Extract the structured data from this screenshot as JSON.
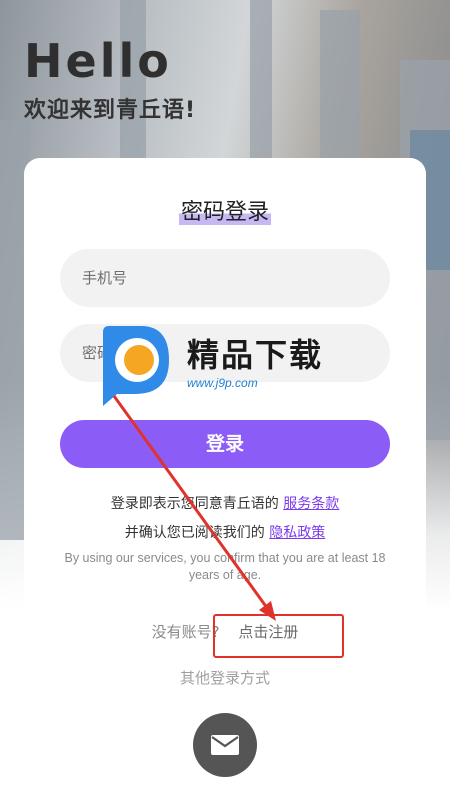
{
  "header": {
    "hello": "Hello",
    "welcome": "欢迎来到青丘语!"
  },
  "login_card": {
    "title": "密码登录",
    "phone_placeholder": "手机号",
    "password_placeholder": "密码",
    "login_button": "登录",
    "terms_prefix": "登录即表示您同意青丘语的",
    "terms_link": "服务条款",
    "privacy_prefix": "并确认您已阅读我们的",
    "privacy_link": "隐私政策",
    "age_note": "By using our services, you confirm that you are at least 18 years of age."
  },
  "register": {
    "prompt": "没有账号?",
    "link": "点击注册"
  },
  "other_login": {
    "label": "其他登录方式",
    "mail_icon": "mail-icon"
  },
  "watermark": {
    "brand": "精品下载",
    "url": "www.j9p.com"
  },
  "colors": {
    "accent": "#8b5cf6",
    "link": "#7c3aed",
    "annotation": "#e0322b"
  }
}
